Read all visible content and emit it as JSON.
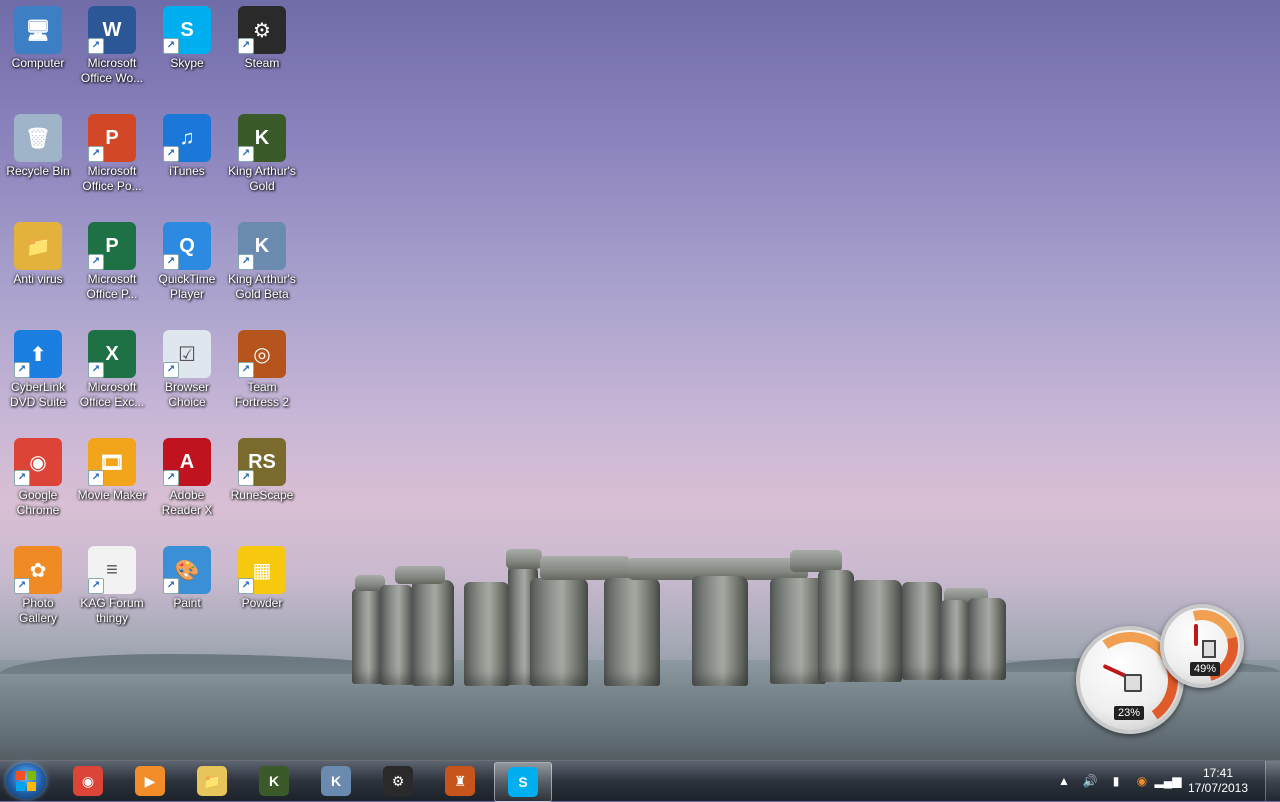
{
  "desktop": {
    "icons": [
      {
        "label": "Computer",
        "icon": "computer-icon",
        "color": "#3d7fc4"
      },
      {
        "label": "Microsoft Office Wo...",
        "icon": "word-icon",
        "color": "#2b5797"
      },
      {
        "label": "Skype",
        "icon": "skype-icon",
        "color": "#00aff0"
      },
      {
        "label": "Steam",
        "icon": "steam-icon",
        "color": "#2a2a2a"
      },
      {
        "label": "Recycle Bin",
        "icon": "recycle-bin-icon",
        "color": "#9fb4c8"
      },
      {
        "label": "Microsoft Office Po...",
        "icon": "powerpoint-icon",
        "color": "#d24726"
      },
      {
        "label": "iTunes",
        "icon": "itunes-icon",
        "color": "#1b78d9"
      },
      {
        "label": "King Arthur's Gold",
        "icon": "kag-icon",
        "color": "#3b5a2a"
      },
      {
        "label": "Anti virus",
        "icon": "folder-icon",
        "color": "#e3b23c"
      },
      {
        "label": "Microsoft Office P...",
        "icon": "publisher-icon",
        "color": "#1e7145"
      },
      {
        "label": "QuickTime Player",
        "icon": "quicktime-icon",
        "color": "#2c8be0"
      },
      {
        "label": "King Arthur's Gold Beta",
        "icon": "kag-beta-icon",
        "color": "#6b8ab0"
      },
      {
        "label": "CyberLink DVD Suite",
        "icon": "cyberlink-icon",
        "color": "#1a7fe0"
      },
      {
        "label": "Microsoft Office Exc...",
        "icon": "excel-icon",
        "color": "#1e7145"
      },
      {
        "label": "Browser Choice",
        "icon": "browser-choice-icon",
        "color": "#dfe6ee"
      },
      {
        "label": "Team Fortress 2",
        "icon": "tf2-icon",
        "color": "#b5541c"
      },
      {
        "label": "Google Chrome",
        "icon": "chrome-icon",
        "color": "#db4437"
      },
      {
        "label": "Movie Maker",
        "icon": "movie-maker-icon",
        "color": "#f2a51b"
      },
      {
        "label": "Adobe Reader X",
        "icon": "adobe-reader-icon",
        "color": "#c1121f"
      },
      {
        "label": "RuneScape",
        "icon": "runescape-icon",
        "color": "#7a6a2e"
      },
      {
        "label": "Photo Gallery",
        "icon": "photo-gallery-icon",
        "color": "#f08a24"
      },
      {
        "label": "KAG Forum thingy",
        "icon": "text-document-icon",
        "color": "#f2f2f2"
      },
      {
        "label": "Paint",
        "icon": "paint-icon",
        "color": "#3b8fd6"
      },
      {
        "label": "Powder",
        "icon": "powder-icon",
        "color": "#f6c90e"
      }
    ]
  },
  "gadgets": {
    "cpu": {
      "value": "23%",
      "icon": "cpu-icon"
    },
    "memory": {
      "value": "49%",
      "icon": "memory-icon"
    }
  },
  "taskbar": {
    "start_icon": "windows-start-icon",
    "items": [
      {
        "icon": "chrome-icon",
        "color": "#db4437",
        "active": false
      },
      {
        "icon": "media-player-icon",
        "color": "#f28c28",
        "active": false
      },
      {
        "icon": "explorer-folder-icon",
        "color": "#e8c55a",
        "active": false
      },
      {
        "icon": "kag-icon",
        "color": "#3b5a2a",
        "active": false
      },
      {
        "icon": "kag-beta-icon",
        "color": "#6b8ab0",
        "active": false
      },
      {
        "icon": "steam-icon",
        "color": "#2a2a2a",
        "active": false
      },
      {
        "icon": "castle-game-icon",
        "color": "#c7541a",
        "active": false
      },
      {
        "icon": "skype-icon",
        "color": "#00aff0",
        "active": true
      }
    ],
    "tray": {
      "icons": [
        "show-hidden-icons-icon",
        "volume-icon",
        "power-icon",
        "avast-icon",
        "network-signal-icon"
      ],
      "time": "17:41",
      "date": "17/07/2013"
    }
  }
}
